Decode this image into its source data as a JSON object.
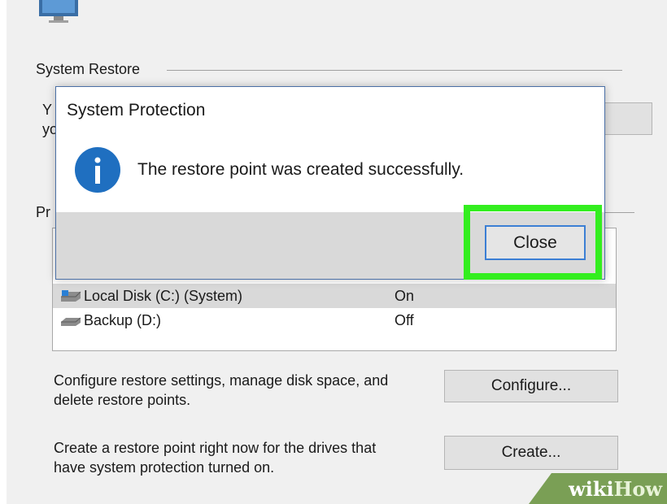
{
  "background": {
    "group_title": "System Restore",
    "clipped_line1": "Y",
    "clipped_line2": "yo",
    "protection_clipped": "Pr",
    "drives": [
      {
        "name": "Local Disk (C:) (System)",
        "protection": "On",
        "icon": "system-drive-icon"
      },
      {
        "name": "Backup (D:)",
        "protection": "Off",
        "icon": "drive-icon"
      }
    ],
    "configure_desc_line1": "Configure restore settings, manage disk space, and",
    "configure_desc_line2": "delete restore points.",
    "configure_button": "Configure...",
    "create_desc_line1": "Create a restore point right now for the drives that",
    "create_desc_line2": "have system protection turned on.",
    "create_button": "Create..."
  },
  "dialog": {
    "title": "System Protection",
    "message": "The restore point was created successfully.",
    "close_button": "Close",
    "icon": "info-icon"
  },
  "highlight_color": "#33ee1f",
  "watermark": {
    "part1": "wiki",
    "part2": "How"
  }
}
